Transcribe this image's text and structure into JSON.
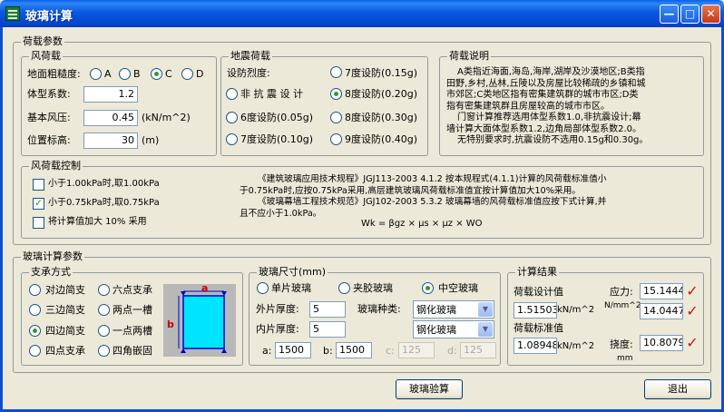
{
  "window": {
    "title": "玻璃计算",
    "minimize": "—",
    "maximize": "□",
    "close": "✕"
  },
  "load_params": {
    "title": "荷载参数",
    "wind": {
      "title": "风荷载",
      "roughness_label": "地面粗糙度:",
      "roughness_options": [
        "A",
        "B",
        "C",
        "D"
      ],
      "roughness_selected": "C",
      "shape_label": "体型系数:",
      "shape_value": "1.2",
      "basic_pressure_label": "基本风压:",
      "basic_pressure_value": "0.45",
      "basic_pressure_unit": "(kN/m^2)",
      "height_label": "位置标高:",
      "height_value": "30",
      "height_unit": "(m)"
    },
    "seismic": {
      "title": "地震荷载",
      "intensity_label": "设防烈度:",
      "options": [
        "7度设防(0.15g)",
        "非 抗 震 设 计",
        "8度设防(0.20g)",
        "6度设防(0.05g)",
        "8度设防(0.30g)",
        "7度设防(0.10g)",
        "9度设防(0.40g)"
      ],
      "selected": "8度设防(0.20g)"
    },
    "description": {
      "title": "荷载说明",
      "lines": [
        "A类指近海面,海岛,海岸,湖岸及沙漠地区;B类指",
        "田野,乡村,丛林,丘陵以及房屋比较稀疏的乡镇和城",
        "市郊区;C类地区指有密集建筑群的城市市区;D类",
        "指有密集建筑群且房屋较高的城市市区。",
        "门窗计算推荐选用体型系数1.0,非抗震设计;幕",
        "墙计算大面体型系数1.2,边角局部体型系数2.0。",
        "无特别要求时,抗震设防不选用0.15g和0.30g。"
      ]
    }
  },
  "wind_control": {
    "title": "风荷载控制",
    "options": [
      {
        "label": "小于1.00kPa时,取1.00kPa",
        "checked": false
      },
      {
        "label": "小于0.75kPa时,取0.75kPa",
        "checked": true
      },
      {
        "label": "将计算值加大 10% 采用",
        "checked": false
      }
    ],
    "code_lines": [
      "《建筑玻璃应用技术规程》JGJ113-2003  4.1.2 按本规程式(4.1.1)计算的风荷载标准值小",
      "于0.75kPa时,应按0.75kPa采用,高层建筑玻璃风荷载标准值宜按计算值加大10%采用。",
      "《玻璃幕墙工程技术规范》JGJ102-2003  5.3.2 玻璃幕墙的风荷载标准值应按下式计算,并",
      "且不应小于1.0kPa。"
    ],
    "formula": "Wk = βgz × μs × μz × WO"
  },
  "glass_params": {
    "title": "玻璃计算参数",
    "support": {
      "title": "支承方式",
      "options": [
        "对边简支",
        "六点支承",
        "三边简支",
        "两点一槽",
        "四边简支",
        "一点两槽",
        "四点支承",
        "四角嵌固"
      ],
      "selected": "四边简支",
      "diagram_a": "a",
      "diagram_b": "b"
    },
    "size": {
      "title": "玻璃尺寸(mm)",
      "types": [
        "单片玻璃",
        "夹胶玻璃",
        "中空玻璃"
      ],
      "type_selected": "中空玻璃",
      "outer_label": "外片厚度:",
      "outer_value": "5",
      "inner_label": "内片厚度:",
      "inner_value": "5",
      "kind_label": "玻璃种类:",
      "kind_outer": "钢化玻璃",
      "kind_inner": "钢化玻璃",
      "a_label": "a:",
      "a_value": "1500",
      "b_label": "b:",
      "b_value": "1500",
      "c_label": "c:",
      "c_value": "125",
      "d_label": "d:",
      "d_value": "125"
    },
    "result": {
      "title": "计算结果",
      "design_label": "荷载设计值",
      "design_value": "1.51503",
      "design_unit": "kN/m^2",
      "std_label": "荷载标准值",
      "std_value": "1.08948",
      "std_unit": "kN/m^2",
      "stress_label": "应力:",
      "stress_unit": "N/mm^2",
      "stress_value1": "15.1444",
      "stress_value2": "14.0447",
      "deflection_label": "挠度:",
      "deflection_unit": "mm",
      "deflection_value": "10.8079",
      "check_mark": "✓"
    }
  },
  "buttons": {
    "check": "玻璃验算",
    "exit": "退出"
  }
}
